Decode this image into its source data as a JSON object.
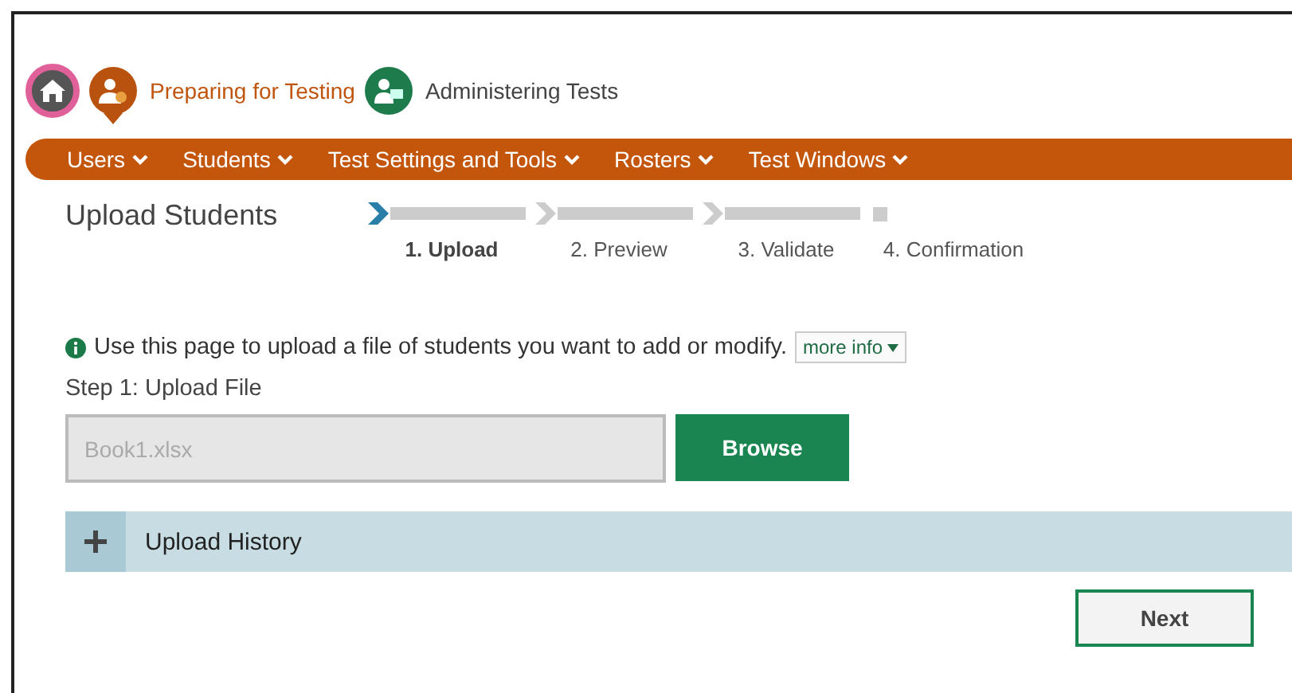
{
  "portal_tabs": [
    {
      "kind": "home",
      "selected": false
    },
    {
      "kind": "preparing",
      "label": "Preparing for Testing",
      "selected": true
    },
    {
      "kind": "administering",
      "label": "Administering Tests",
      "selected": false
    }
  ],
  "nav": [
    "Users",
    "Students",
    "Test Settings and Tools",
    "Rosters",
    "Test Windows"
  ],
  "page_title": "Upload Students",
  "steps": [
    {
      "label": "1. Upload",
      "selected": true
    },
    {
      "label": "2. Preview",
      "selected": false
    },
    {
      "label": "3. Validate",
      "selected": false
    },
    {
      "label": "4. Confirmation",
      "selected": false
    }
  ],
  "info": {
    "text": "Use this page to upload a file of students you want to add or modify.",
    "more_info": "more info"
  },
  "step_label": "Step 1: Upload File",
  "file_field": {
    "value": "Book1.xlsx"
  },
  "browse_button": "Browse",
  "upload_history": {
    "label": "Upload History",
    "expanded": false
  },
  "next_button": "Next"
}
